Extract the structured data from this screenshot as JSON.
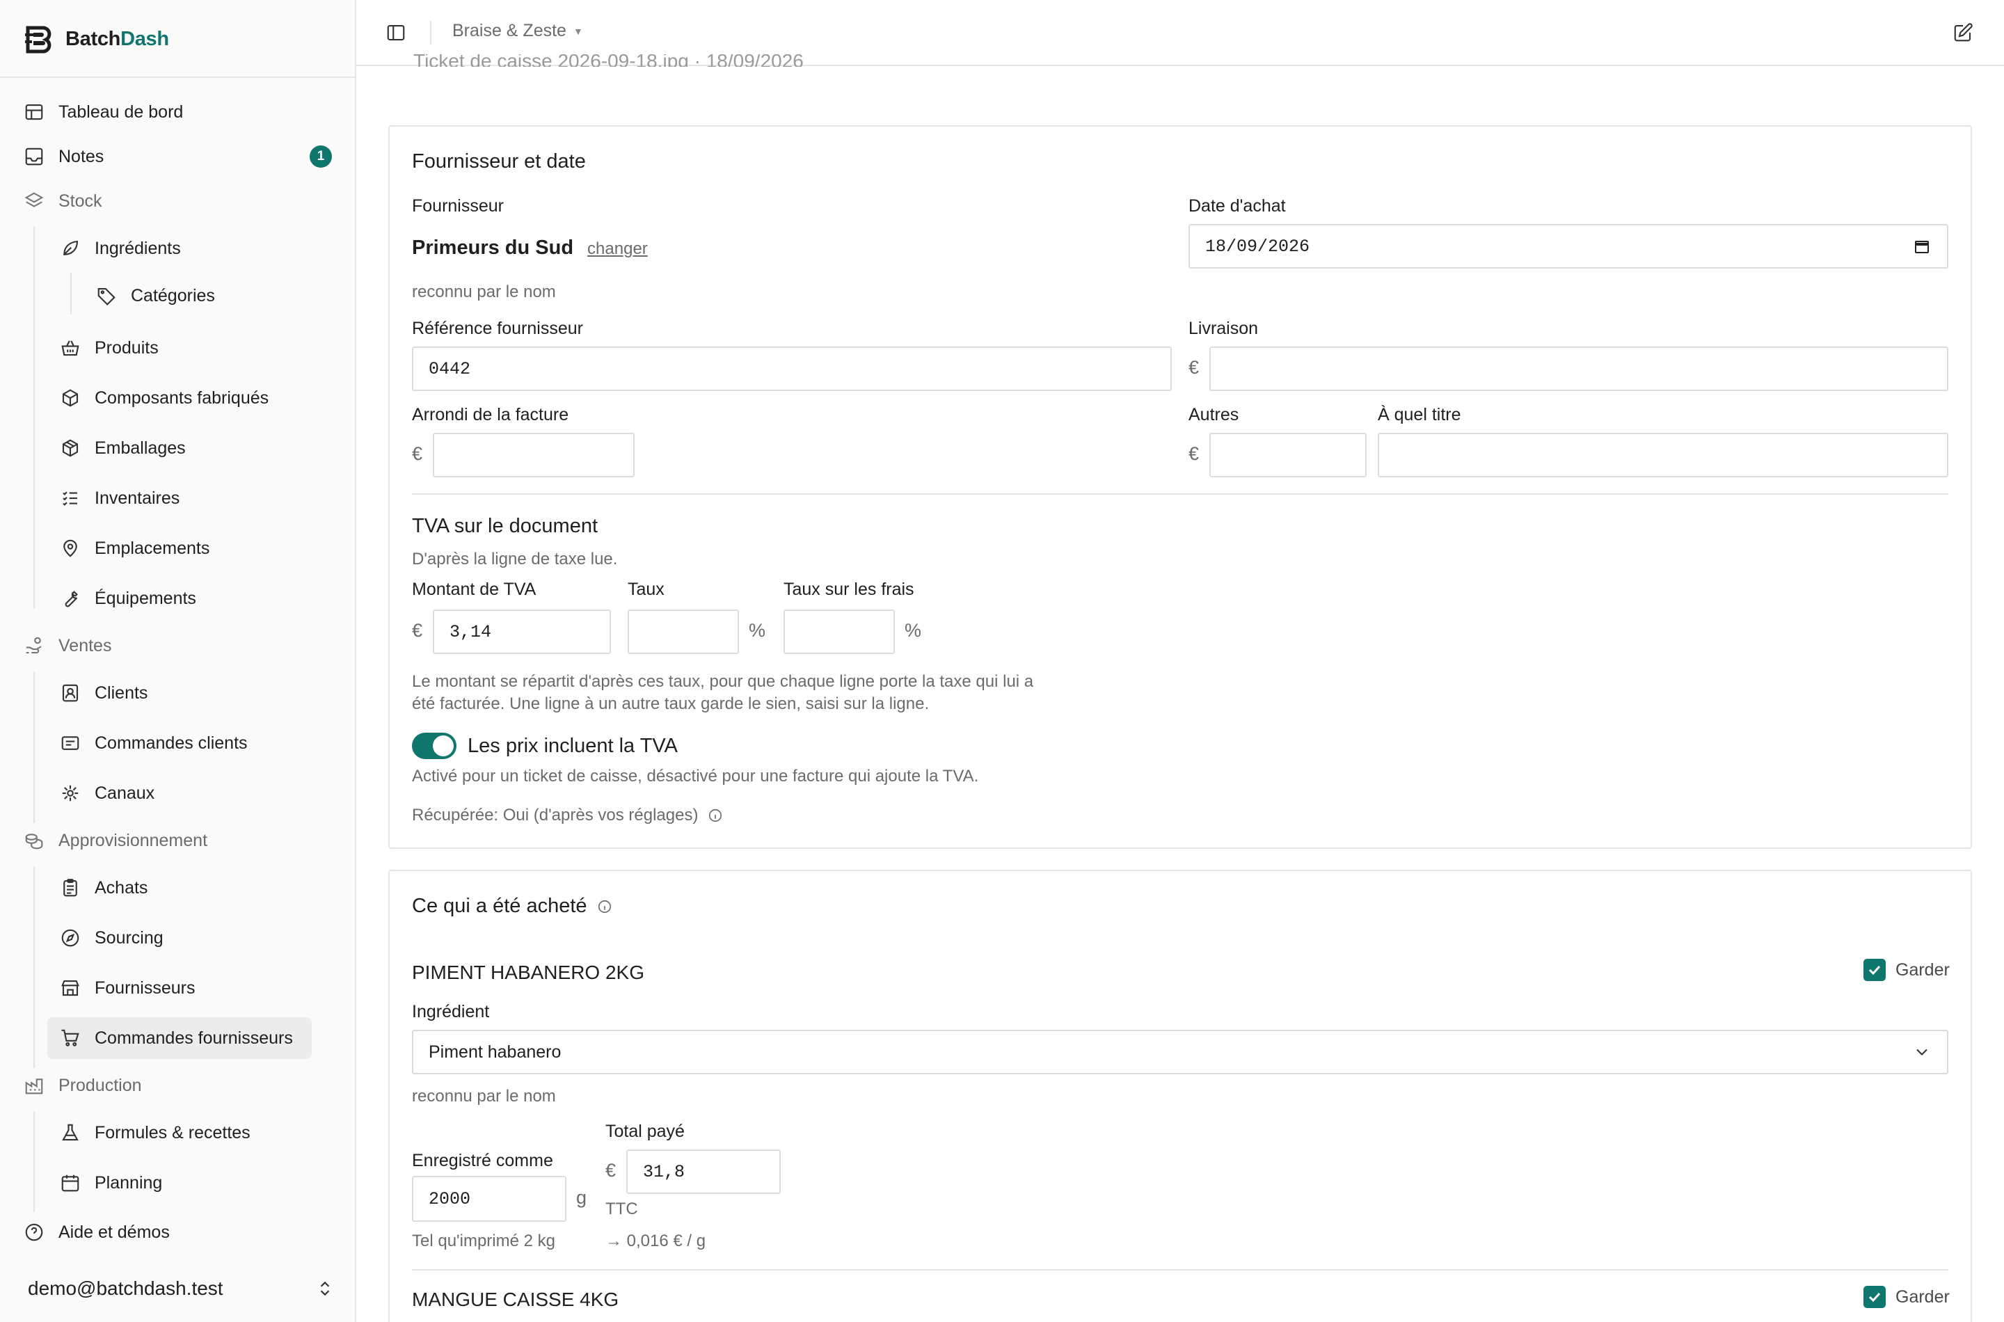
{
  "brand": {
    "name_a": "Batch",
    "name_b": "Dash"
  },
  "nav": {
    "tableau": "Tableau de bord",
    "notes": "Notes",
    "notes_badge": "1",
    "stock": "Stock",
    "ingredients": "Ingrédients",
    "categories": "Catégories",
    "produits": "Produits",
    "composants": "Composants fabriqués",
    "emballages": "Emballages",
    "inventaires": "Inventaires",
    "emplacements": "Emplacements",
    "equipements": "Équipements",
    "ventes": "Ventes",
    "clients": "Clients",
    "commandes_clients": "Commandes clients",
    "canaux": "Canaux",
    "approvisionnement": "Approvisionnement",
    "achats": "Achats",
    "sourcing": "Sourcing",
    "fournisseurs": "Fournisseurs",
    "commandes_fournisseurs": "Commandes fournisseurs",
    "production": "Production",
    "formules": "Formules & recettes",
    "planning": "Planning",
    "aide": "Aide et démos"
  },
  "user": {
    "email": "demo@batchdash.test"
  },
  "topbar": {
    "workspace": "Braise & Zeste"
  },
  "doc": {
    "title": "Ticket de caisse 2026-09-18.jpg · 18/09/2026"
  },
  "supplier_card": {
    "title": "Fournisseur et date",
    "supplier_label": "Fournisseur",
    "supplier_name": "Primeurs du Sud",
    "change_link": "changer",
    "recognized": "reconnu par le nom",
    "date_label": "Date d'achat",
    "date_value": "18/09/2026",
    "ref_label": "Référence fournisseur",
    "ref_value": "0442",
    "delivery_label": "Livraison",
    "delivery_value": "",
    "rounding_label": "Arrondi de la facture",
    "rounding_value": "",
    "other_label": "Autres",
    "other_value": "",
    "reason_label": "À quel titre",
    "reason_value": "",
    "currency": "€",
    "vat_title": "TVA sur le document",
    "vat_sub": "D'après la ligne de taxe lue.",
    "vat_amount_label": "Montant de TVA",
    "vat_amount_value": "3,14",
    "vat_rate_label": "Taux",
    "vat_rate_value": "",
    "vat_fees_label": "Taux sur les frais",
    "vat_fees_value": "",
    "percent": "%",
    "vat_note_1": "Le montant se répartit d'après ces taux, pour que chaque ligne porte la taxe qui lui a",
    "vat_note_2": "été facturée. Une ligne à un autre taux garde le sien, saisi sur la ligne.",
    "toggle_label": "Les prix incluent la TVA",
    "toggle_on": true,
    "toggle_note": "Activé pour un ticket de caisse, désactivé pour une facture qui ajoute la TVA.",
    "recovered": "Récupérée: Oui (d'après vos réglages)"
  },
  "items_card": {
    "title": "Ce qui a été acheté",
    "keep_label": "Garder",
    "items": [
      {
        "name": "PIMENT HABANERO 2KG",
        "keep": true,
        "ingredient_label": "Ingrédient",
        "ingredient_value": "Piment habanero",
        "recognized": "reconnu par le nom",
        "recorded_label": "Enregistré comme",
        "recorded_value": "2000",
        "unit": "g",
        "printed_as": "Tel qu'imprimé 2 kg",
        "total_label": "Total payé",
        "total_value": "31,8",
        "ttc": "TTC",
        "unit_price": "→ 0,016 € / g"
      },
      {
        "name": "MANGUE CAISSE 4KG",
        "keep": true
      }
    ]
  },
  "colors": {
    "accent": "#0f766e",
    "border": "#e6e6e4",
    "muted": "#6b6b6b"
  }
}
